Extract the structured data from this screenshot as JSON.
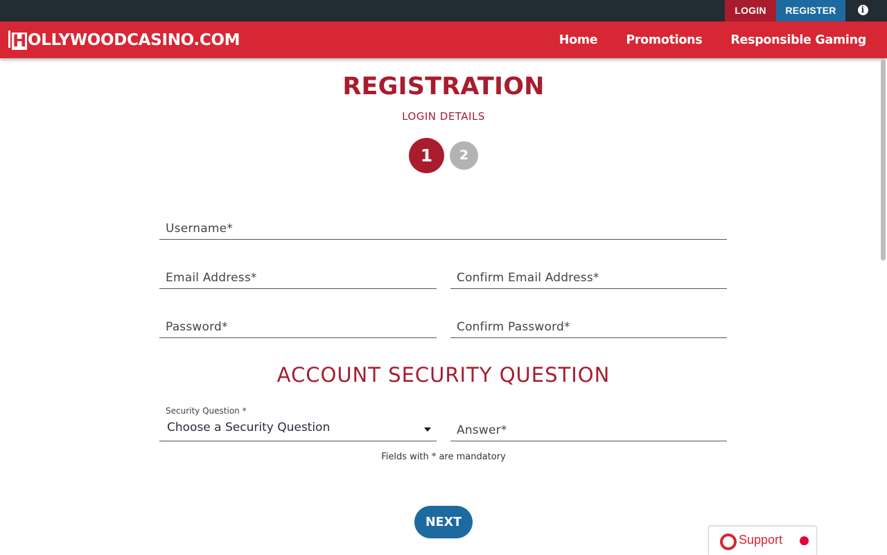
{
  "topbar": {
    "login_label": "LOGIN",
    "register_label": "REGISTER",
    "info_icon": "info-icon",
    "info_glyph": "i"
  },
  "header": {
    "logo_text": "OLLYWOODCASINO.COM",
    "logo_initial": "H",
    "nav": [
      "Home",
      "Promotions",
      "Responsible Gaming"
    ]
  },
  "main": {
    "title": "REGISTRATION",
    "subtitle": "LOGIN DETAILS",
    "steps": [
      "1",
      "2"
    ],
    "current_step": "1",
    "fields": {
      "username": {
        "placeholder": "Username*",
        "value": ""
      },
      "email": {
        "placeholder": "Email Address*",
        "value": ""
      },
      "confirm_email": {
        "placeholder": "Confirm Email Address*",
        "value": ""
      },
      "password": {
        "placeholder": "Password*",
        "value": ""
      },
      "confirm_password": {
        "placeholder": "Confirm Password*",
        "value": ""
      },
      "answer": {
        "placeholder": "Answer*",
        "value": ""
      }
    },
    "security_section_title": "ACCOUNT SECURITY QUESTION",
    "security_question_label": "Security Question *",
    "security_question_value": "Choose a Security Question",
    "mandatory_note": "Fields with * are mandatory",
    "next_label": "NEXT"
  },
  "support": {
    "label": "Support",
    "icon": "lifebuoy-icon",
    "status_color": "#e3003b"
  },
  "colors": {
    "topbar": "#222c33",
    "header": "#d72634",
    "brand_dark_red": "#a81c2e",
    "primary_blue": "#1d6aa1",
    "step_inactive": "#b3b3b3"
  }
}
